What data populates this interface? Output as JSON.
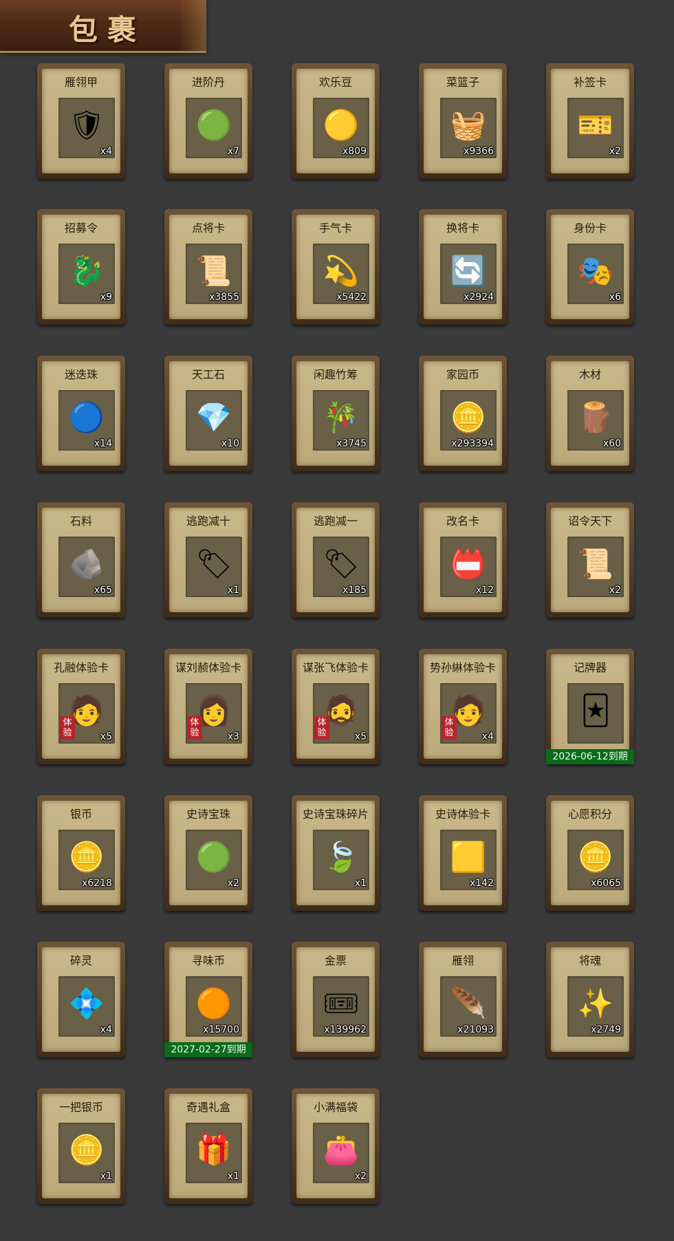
{
  "header": {
    "title": "包裹"
  },
  "items": [
    {
      "name": "雁翎甲",
      "count": "x4",
      "icon": "armor-icon",
      "glyph": "🛡",
      "trial": "",
      "expiry": ""
    },
    {
      "name": "进阶丹",
      "count": "x7",
      "icon": "green-pill-icon",
      "glyph": "🟢",
      "trial": "",
      "expiry": ""
    },
    {
      "name": "欢乐豆",
      "count": "x809",
      "icon": "gold-beans-icon",
      "glyph": "🟡",
      "trial": "",
      "expiry": ""
    },
    {
      "name": "菜篮子",
      "count": "x9366",
      "icon": "vegetable-basket-icon",
      "glyph": "🧺",
      "trial": "",
      "expiry": ""
    },
    {
      "name": "补签卡",
      "count": "x2",
      "icon": "sign-card-icon",
      "glyph": "🎫",
      "trial": "",
      "expiry": ""
    },
    {
      "name": "招募令",
      "count": "x9",
      "icon": "recruit-token-icon",
      "glyph": "🐉",
      "trial": "",
      "expiry": ""
    },
    {
      "name": "点将卡",
      "count": "x3855",
      "icon": "general-card-icon",
      "glyph": "📜",
      "trial": "",
      "expiry": ""
    },
    {
      "name": "手气卡",
      "count": "x5422",
      "icon": "luck-card-icon",
      "glyph": "💫",
      "trial": "",
      "expiry": ""
    },
    {
      "name": "换将卡",
      "count": "x2924",
      "icon": "swap-general-card-icon",
      "glyph": "🔄",
      "trial": "",
      "expiry": ""
    },
    {
      "name": "身份卡",
      "count": "x6",
      "icon": "identity-mask-icon",
      "glyph": "🎭",
      "trial": "",
      "expiry": ""
    },
    {
      "name": "迷迭珠",
      "count": "x14",
      "icon": "blue-orb-icon",
      "glyph": "🔵",
      "trial": "",
      "expiry": ""
    },
    {
      "name": "天工石",
      "count": "x10",
      "icon": "blue-crystal-icon",
      "glyph": "💎",
      "trial": "",
      "expiry": ""
    },
    {
      "name": "闲趣竹筹",
      "count": "x3745",
      "icon": "bamboo-tally-icon",
      "glyph": "🎋",
      "trial": "",
      "expiry": ""
    },
    {
      "name": "家园币",
      "count": "x293394",
      "icon": "home-coin-icon",
      "glyph": "🪙",
      "trial": "",
      "expiry": ""
    },
    {
      "name": "木材",
      "count": "x60",
      "icon": "wood-icon",
      "glyph": "🪵",
      "trial": "",
      "expiry": ""
    },
    {
      "name": "石料",
      "count": "x65",
      "icon": "stone-icon",
      "glyph": "🪨",
      "trial": "",
      "expiry": ""
    },
    {
      "name": "逃跑减十",
      "count": "x1",
      "icon": "jade-tag-icon",
      "glyph": "🏷",
      "trial": "",
      "expiry": ""
    },
    {
      "name": "逃跑减一",
      "count": "x185",
      "icon": "jade-tag-icon",
      "glyph": "🏷",
      "trial": "",
      "expiry": ""
    },
    {
      "name": "改名卡",
      "count": "x12",
      "icon": "rename-tag-icon",
      "glyph": "📛",
      "trial": "",
      "expiry": ""
    },
    {
      "name": "诏令天下",
      "count": "x2",
      "icon": "edict-scroll-icon",
      "glyph": "📜",
      "trial": "",
      "expiry": ""
    },
    {
      "name": "孔融体验卡",
      "count": "x5",
      "icon": "general-portrait-icon",
      "glyph": "🧑",
      "trial": "体验",
      "expiry": ""
    },
    {
      "name": "谋刘赪体验卡",
      "count": "x3",
      "icon": "general-portrait-icon",
      "glyph": "👩",
      "trial": "体验",
      "expiry": ""
    },
    {
      "name": "谋张飞体验卡",
      "count": "x5",
      "icon": "general-portrait-icon",
      "glyph": "🧔",
      "trial": "体验",
      "expiry": ""
    },
    {
      "name": "势孙綝体验卡",
      "count": "x4",
      "icon": "general-portrait-icon",
      "glyph": "🧑",
      "trial": "体验",
      "expiry": ""
    },
    {
      "name": "记牌器",
      "count": "",
      "icon": "playing-cards-icon",
      "glyph": "🃏",
      "trial": "",
      "expiry": "2026-06-12到期"
    },
    {
      "name": "银币",
      "count": "x6218",
      "icon": "silver-coin-icon",
      "glyph": "🪙",
      "trial": "",
      "expiry": ""
    },
    {
      "name": "史诗宝珠",
      "count": "x2",
      "icon": "green-orb-icon",
      "glyph": "🟢",
      "trial": "",
      "expiry": ""
    },
    {
      "name": "史诗宝珠碎片",
      "count": "x1",
      "icon": "green-shard-icon",
      "glyph": "🍃",
      "trial": "",
      "expiry": ""
    },
    {
      "name": "史诗体验卡",
      "count": "x142",
      "icon": "gold-card-icon",
      "glyph": "🟨",
      "trial": "",
      "expiry": ""
    },
    {
      "name": "心愿积分",
      "count": "x6065",
      "icon": "heart-coin-icon",
      "glyph": "🪙",
      "trial": "",
      "expiry": ""
    },
    {
      "name": "碎灵",
      "count": "x4",
      "icon": "spirit-shard-icon",
      "glyph": "💠",
      "trial": "",
      "expiry": ""
    },
    {
      "name": "寻味币",
      "count": "x15700",
      "icon": "flavor-coin-icon",
      "glyph": "🟠",
      "trial": "",
      "expiry": "2027-02-27到期"
    },
    {
      "name": "金票",
      "count": "x139962",
      "icon": "gold-ticket-icon",
      "glyph": "🎟",
      "trial": "",
      "expiry": ""
    },
    {
      "name": "雁翎",
      "count": "x21093",
      "icon": "feather-icon",
      "glyph": "🪶",
      "trial": "",
      "expiry": ""
    },
    {
      "name": "将魂",
      "count": "x2749",
      "icon": "green-soul-icon",
      "glyph": "✨",
      "trial": "",
      "expiry": ""
    },
    {
      "name": "一把银币",
      "count": "x1",
      "icon": "silver-coins-icon",
      "glyph": "🪙",
      "trial": "",
      "expiry": ""
    },
    {
      "name": "奇遇礼盒",
      "count": "x1",
      "icon": "gift-box-icon",
      "glyph": "🎁",
      "trial": "",
      "expiry": ""
    },
    {
      "name": "小满福袋",
      "count": "x2",
      "icon": "lucky-bag-icon",
      "glyph": "👛",
      "trial": "",
      "expiry": ""
    }
  ]
}
